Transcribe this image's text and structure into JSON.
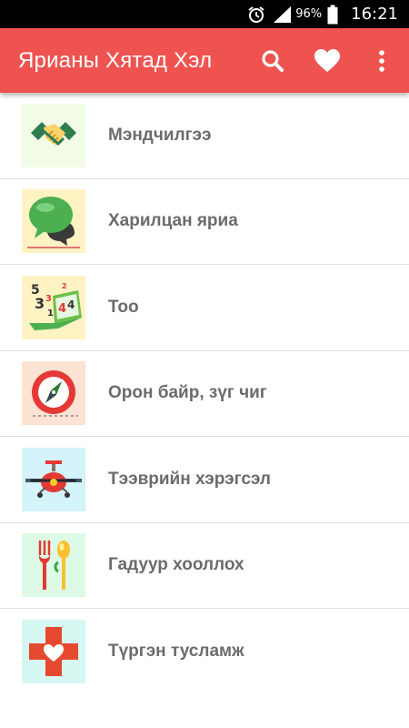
{
  "status_bar": {
    "battery_percent": "96%",
    "time": "16:21",
    "icons": [
      "alarm-icon",
      "signal-icon",
      "battery-icon"
    ]
  },
  "app_bar": {
    "title": "Ярианы Хятад Хэл",
    "actions": [
      "search-icon",
      "heart-icon",
      "more-vert-icon"
    ]
  },
  "categories": [
    {
      "label": "Мэндчилгээ",
      "icon": "handshake-icon",
      "bg": "#f2fbe6"
    },
    {
      "label": "Харилцан яриа",
      "icon": "speech-bubbles-icon",
      "bg": "#fff3c4"
    },
    {
      "label": "Тоо",
      "icon": "numbers-laptop-icon",
      "bg": "#fff3c4"
    },
    {
      "label": "Орон байр, зүг чиг",
      "icon": "compass-icon",
      "bg": "#fde3d3"
    },
    {
      "label": "Тээврийн хэрэгсэл",
      "icon": "airplane-icon",
      "bg": "#d4f3fb"
    },
    {
      "label": "Гадуур хооллох",
      "icon": "fork-spoon-icon",
      "bg": "#dcfae6"
    },
    {
      "label": "Түргэн тусламж",
      "icon": "first-aid-icon",
      "bg": "#d7f7f3"
    }
  ]
}
